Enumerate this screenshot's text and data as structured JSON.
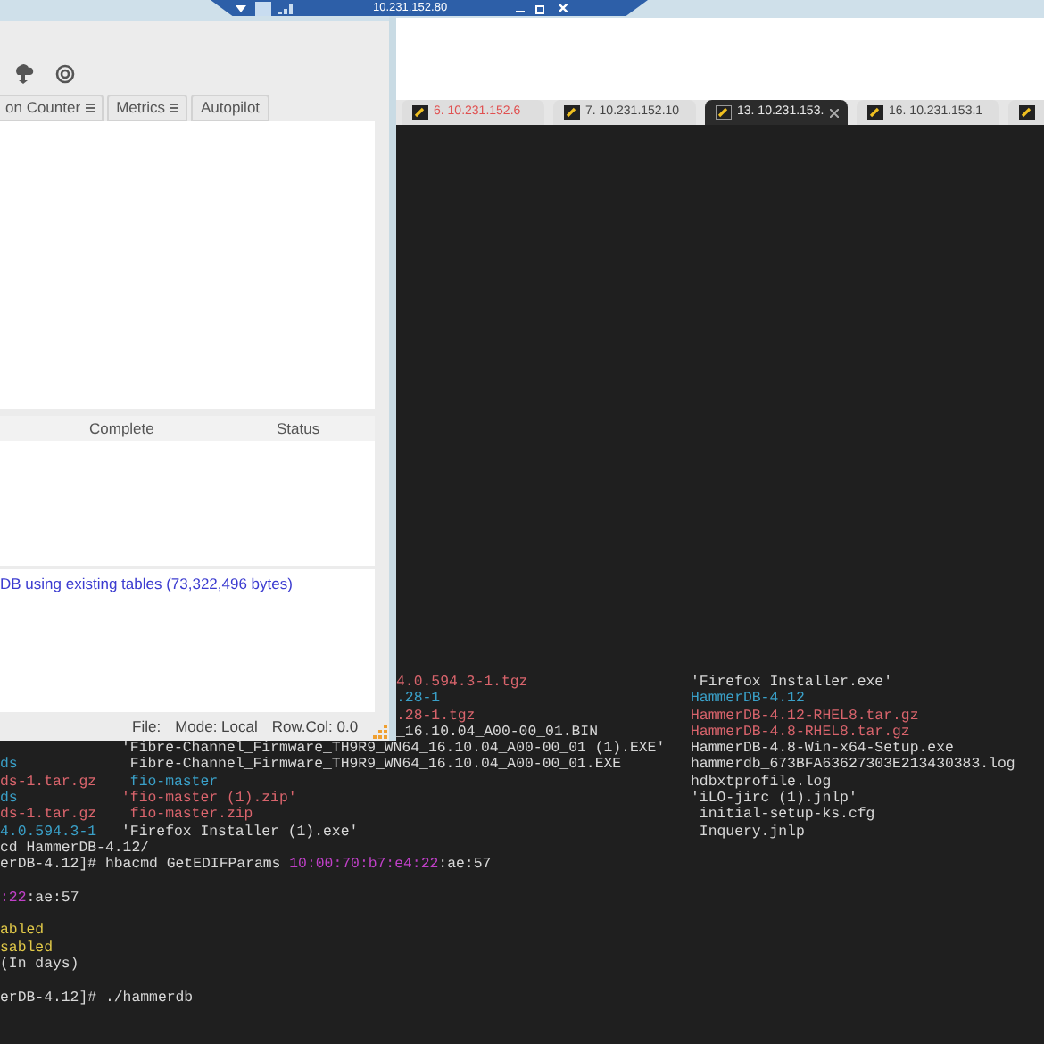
{
  "remote_toolbar": {
    "title": "10.231.152.80"
  },
  "hammerdb": {
    "toolbar_tabs": [
      {
        "label": "on Counter",
        "menu": true
      },
      {
        "label": "Metrics",
        "menu": true
      },
      {
        "label": "Autopilot",
        "menu": false
      }
    ],
    "table": {
      "columns": [
        "Complete",
        "Status"
      ]
    },
    "log": "DB using existing tables (73,322,496 bytes)",
    "status_bar": [
      "File:",
      "Mode: Local",
      "Row.Col: 0.0"
    ]
  },
  "session_tabs": [
    {
      "label": "6. 10.231.152.6",
      "disconnected": true,
      "selected": false,
      "closable": false
    },
    {
      "label": "7. 10.231.152.10",
      "disconnected": false,
      "selected": false,
      "closable": false
    },
    {
      "label": "13. 10.231.153.",
      "disconnected": false,
      "selected": true,
      "closable": true
    },
    {
      "label": "16. 10.231.153.1",
      "disconnected": false,
      "selected": false,
      "closable": false
    },
    {
      "selected": false
    }
  ],
  "terminal": [
    {
      "kind": "overlapped",
      "middle": {
        "text": "4.0.594.3-1.tgz",
        "color": "#d9646c"
      },
      "right": {
        "text": "'Firefox Installer.exe'",
        "color": "#d8d8d8"
      }
    },
    {
      "kind": "overlapped",
      "middle": {
        "text": ".28-1",
        "color": "#3aa0c8"
      },
      "right": {
        "text": "HammerDB-4.12",
        "color": "#3aa0c8"
      }
    },
    {
      "kind": "overlapped",
      "middle": {
        "text": ".28-1.tgz",
        "color": "#d9646c"
      },
      "right": {
        "text": "HammerDB-4.12-RHEL8.tar.gz",
        "color": "#d9646c"
      }
    },
    {
      "kind": "overlapped",
      "middle": {
        "text": "_16.10.04_A00-00_01.BIN",
        "color": "#d8d8d8"
      },
      "right": {
        "text": "HammerDB-4.8-RHEL8.tar.gz",
        "color": "#d9646c"
      }
    },
    {
      "kind": "columns",
      "middle": {
        "text": "'Fibre-Channel_Firmware_TH9R9_WN64_16.10.04_A00-00_01 (1).EXE'",
        "color": "#d8d8d8"
      },
      "right": {
        "text": "HammerDB-4.8-Win-x64-Setup.exe",
        "color": "#d8d8d8"
      }
    },
    {
      "kind": "columns",
      "left": {
        "text": "ds",
        "color": "#3aa0c8"
      },
      "middle": {
        "text": " Fibre-Channel_Firmware_TH9R9_WN64_16.10.04_A00-00_01.EXE",
        "color": "#d8d8d8"
      },
      "right": {
        "text": "hammerdb_673BFA63627303E213430383.log",
        "color": "#d8d8d8"
      }
    },
    {
      "kind": "columns",
      "left": {
        "text": "ds-1.tar.gz",
        "color": "#d9646c"
      },
      "middle": {
        "text": " fio-master",
        "color": "#3aa0c8"
      },
      "right": {
        "text": "hdbxtprofile.log",
        "color": "#d8d8d8"
      }
    },
    {
      "kind": "columns",
      "left": {
        "text": "ds",
        "color": "#3aa0c8"
      },
      "middle": {
        "text": "'fio-master (1).zip'",
        "color": "#d9646c"
      },
      "right": {
        "text": "'iLO-jirc (1).jnlp'",
        "color": "#d8d8d8"
      }
    },
    {
      "kind": "columns",
      "left": {
        "text": "ds-1.tar.gz",
        "color": "#d9646c"
      },
      "middle": {
        "text": " fio-master.zip",
        "color": "#d9646c"
      },
      "right": {
        "text": " initial-setup-ks.cfg",
        "color": "#d8d8d8"
      }
    },
    {
      "kind": "columns",
      "left": {
        "text": "4.0.594.3-1",
        "color": "#3aa0c8"
      },
      "middle": {
        "text": "'Firefox Installer (1).exe'",
        "color": "#d8d8d8"
      },
      "right": {
        "text": " Inquery.jnlp",
        "color": "#d8d8d8"
      }
    },
    {
      "kind": "line",
      "spans": [
        {
          "text": "cd HammerDB-4.12/",
          "color": "#d8d8d8"
        }
      ]
    },
    {
      "kind": "line",
      "spans": [
        {
          "text": "erDB-4.12]# hbacmd GetEDIFParams ",
          "color": "#d8d8d8"
        },
        {
          "text": "10:00:70:b7:e4:22",
          "color": "#c040c8"
        },
        {
          "text": ":ae:57",
          "color": "#d8d8d8"
        }
      ]
    },
    {
      "kind": "blank"
    },
    {
      "kind": "line",
      "spans": [
        {
          "text": ":22",
          "color": "#c040c8"
        },
        {
          "text": ":ae:57",
          "color": "#d8d8d8"
        }
      ]
    },
    {
      "kind": "blank"
    },
    {
      "kind": "line",
      "spans": [
        {
          "text": "abled",
          "color": "#e0c848"
        }
      ]
    },
    {
      "kind": "line",
      "spans": [
        {
          "text": "sabled",
          "color": "#e0c848"
        }
      ]
    },
    {
      "kind": "line",
      "spans": [
        {
          "text": "(In days)",
          "color": "#d8d8d8"
        }
      ]
    },
    {
      "kind": "blank"
    },
    {
      "kind": "line",
      "spans": [
        {
          "text": "erDB-4.12]# ./hammerdb",
          "color": "#d8d8d8"
        }
      ]
    }
  ]
}
